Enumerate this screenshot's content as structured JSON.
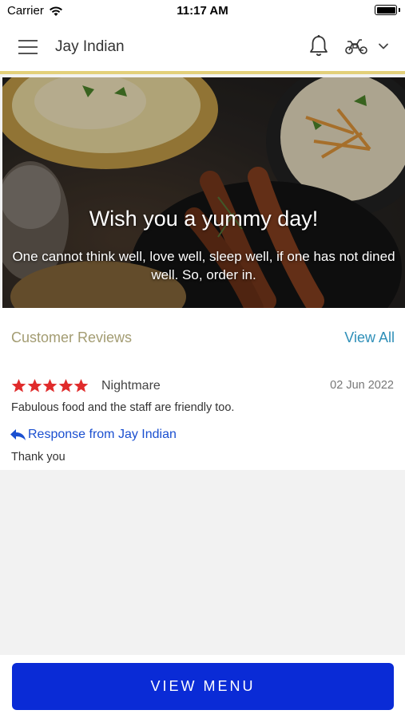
{
  "status_bar": {
    "carrier": "Carrier",
    "time": "11:17 AM"
  },
  "nav": {
    "title": "Jay Indian",
    "icons": [
      "menu-icon",
      "bell-icon",
      "scooter-icon",
      "chevron-down-icon"
    ],
    "accent_color": "#e3d07a"
  },
  "hero": {
    "title": "Wish you a yummy day!",
    "subtitle": "One cannot think well, love well, sleep well, if one has not dined well. So, order in."
  },
  "reviews": {
    "heading": "Customer Reviews",
    "view_all": "View All",
    "items": [
      {
        "rating": 5,
        "reviewer": "Nightmare",
        "date": "02 Jun 2022",
        "text": "Fabulous food and the staff are friendly too.",
        "response_label": "Response from Jay Indian",
        "response_text": "Thank you"
      }
    ],
    "star_color": "#e02b2b",
    "link_color": "#1a4fd0"
  },
  "footer": {
    "button_label": "VIEW MENU",
    "button_color": "#0a2bd6"
  }
}
